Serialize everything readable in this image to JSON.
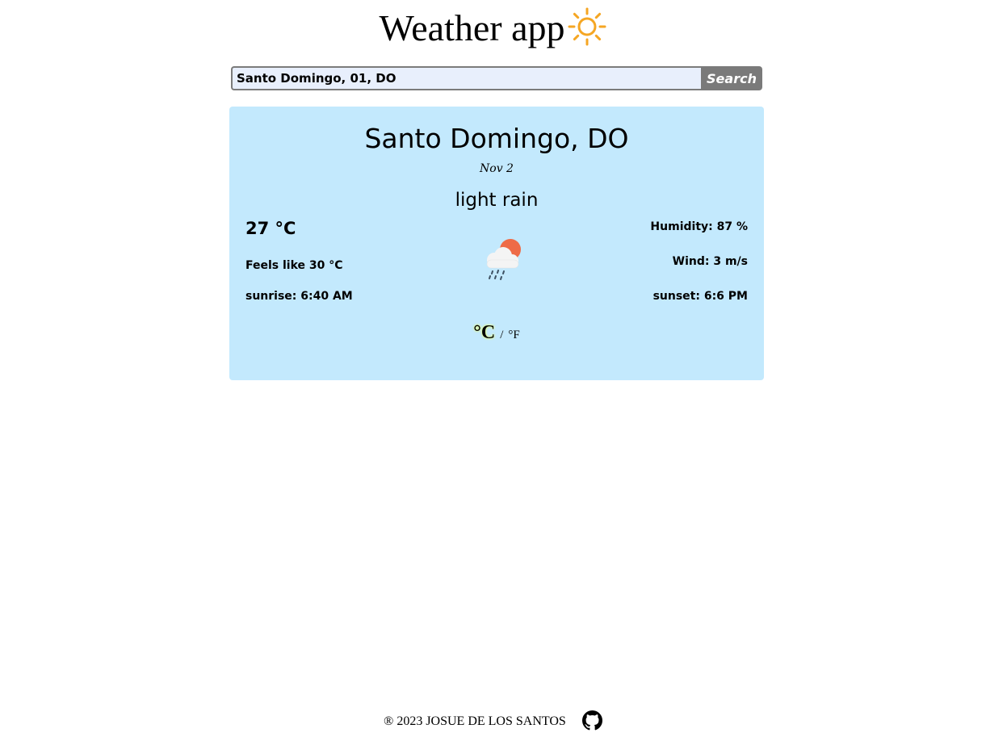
{
  "header": {
    "title": "Weather app",
    "icon": "sun-icon",
    "icon_color": "#f5a623"
  },
  "search": {
    "value": "Santo Domingo, 01, DO",
    "placeholder": "",
    "button_label": "Search"
  },
  "weather": {
    "city": "Santo Domingo, DO",
    "date": "Nov 2",
    "description": "light rain",
    "temperature": "27 °C",
    "feels_like": "Feels like 30 °C",
    "sunrise": "sunrise: 6:40 AM",
    "humidity": "Humidity: 87 %",
    "wind": "Wind: 3 m/s",
    "sunset": "sunset: 6:6 PM",
    "icon": "cloud-sun-rain-icon",
    "card_color": "#c3e9fd"
  },
  "units": {
    "celsius": "°C",
    "separator": "/",
    "fahrenheit": "°F",
    "active": "celsius"
  },
  "footer": {
    "text": "® 2023 JOSUE DE LOS SANTOS",
    "icon": "github-icon"
  }
}
